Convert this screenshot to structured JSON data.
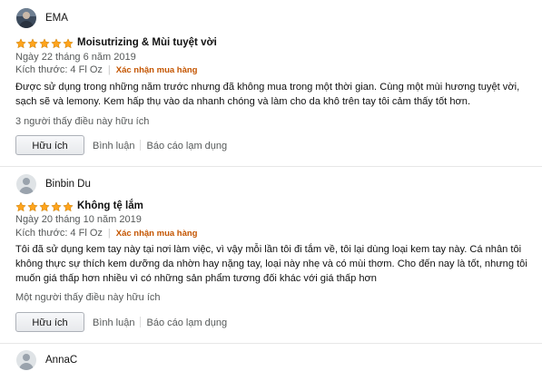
{
  "reviews": [
    {
      "reviewer": "EMA",
      "rating": 5,
      "title": "Moisutrizing & Mùi tuyệt vời",
      "date": "Ngày 22 tháng 6 năm 2019",
      "size": "Kích thước: 4 Fl Oz",
      "verified": "Xác nhận mua hàng",
      "body": "Được sử dụng trong những năm trước nhưng đã không mua trong một thời gian. Cùng một mùi hương tuyệt vời, sạch sẽ và lemony. Kem hấp thụ vào da nhanh chóng và làm cho da khô trên tay tôi cảm thấy tốt hơn.",
      "helpful_count": "3 người thấy điều này hữu ích",
      "helpful_button": "Hữu ích",
      "comment": "Bình luận",
      "report": "Báo cáo lạm dụng"
    },
    {
      "reviewer": "Binbin Du",
      "rating": 5,
      "title": "Không tệ lắm",
      "date": "Ngày 20 tháng 10 năm 2019",
      "size": "Kích thước: 4 Fl Oz",
      "verified": "Xác nhận mua hàng",
      "body": "Tôi đã sử dụng kem tay này tại nơi làm việc, vì vậy mỗi lần tôi đi tắm về, tôi lại dùng loại kem tay này. Cá nhân tôi không thực sự thích kem dưỡng da nhờn hay nặng tay, loại này nhẹ và có mùi thơm. Cho đến nay là tốt, nhưng tôi muốn giá thấp hơn nhiều vì có những sản phẩm tương đối khác với giá thấp hơn",
      "helpful_count": "Một người thấy điều này hữu ích",
      "helpful_button": "Hữu ích",
      "comment": "Bình luận",
      "report": "Báo cáo lạm dụng"
    },
    {
      "reviewer": "AnnaC"
    }
  ],
  "colors": {
    "star": "#ffa41c",
    "verified": "#c45500",
    "secondary_text": "#565959"
  }
}
